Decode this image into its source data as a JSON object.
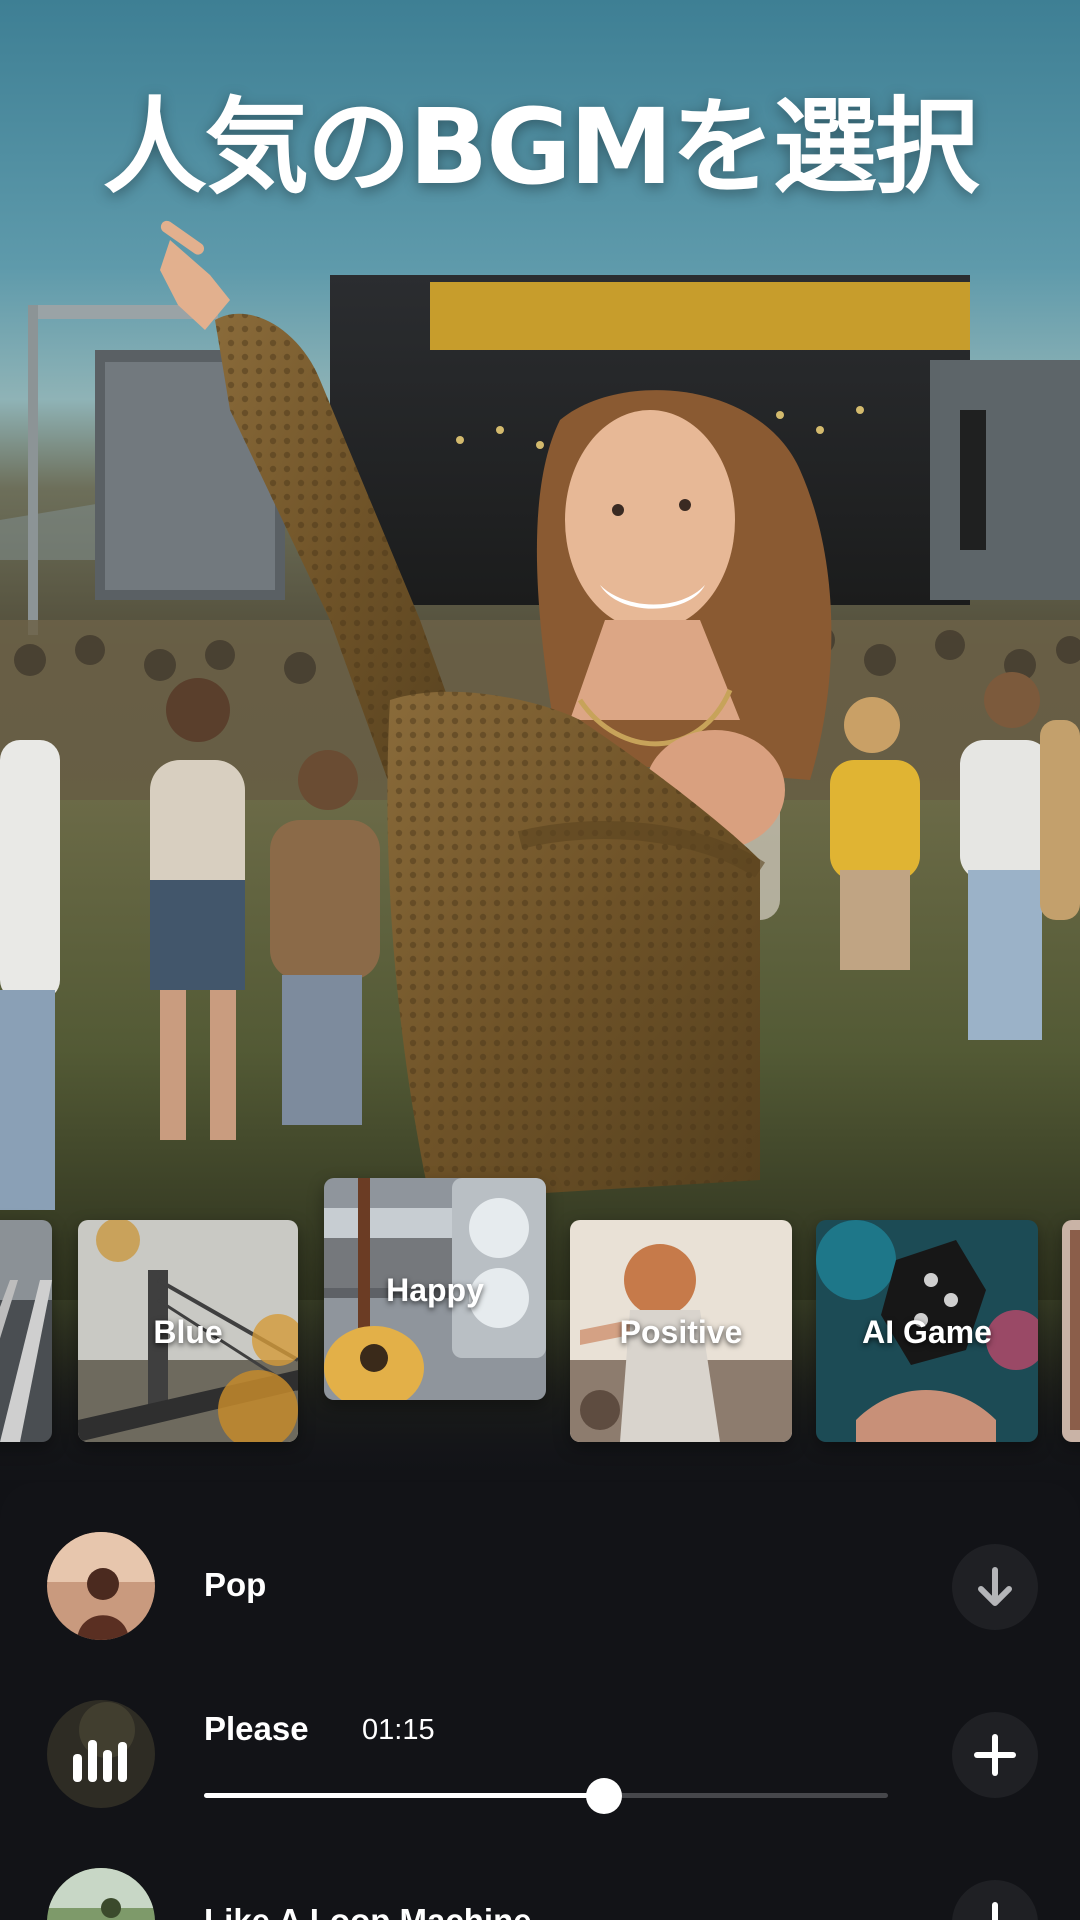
{
  "headline": "人気のBGMを選択",
  "genres": [
    {
      "label": "",
      "image": "railway-track-photo"
    },
    {
      "label": "Blue",
      "image": "bridge-autumn-photo"
    },
    {
      "label": "Happy",
      "image": "guitar-amp-photo"
    },
    {
      "label": "Positive",
      "image": "girl-seaside-photo"
    },
    {
      "label": "AI Game",
      "image": "dice-neon-photo"
    },
    {
      "label": "",
      "image": "partial-card-photo"
    }
  ],
  "selected_genre": "Happy",
  "tracks": [
    {
      "title": "Pop",
      "action": "download-icon",
      "thumb": "girl-sunset-photo"
    },
    {
      "title": "Please",
      "duration": "01:15",
      "action": "add-icon",
      "thumb": "equalizer-bars-icon",
      "progress": 0.585,
      "playing": true
    },
    {
      "title": "Like A Loop Machine",
      "action": "add-icon",
      "thumb": "field-photo"
    }
  ],
  "colors": {
    "panel_bg": "#121317",
    "button_bg": "#1f2024",
    "slider_track": "#46474b",
    "slider_fill": "#ffffff"
  }
}
